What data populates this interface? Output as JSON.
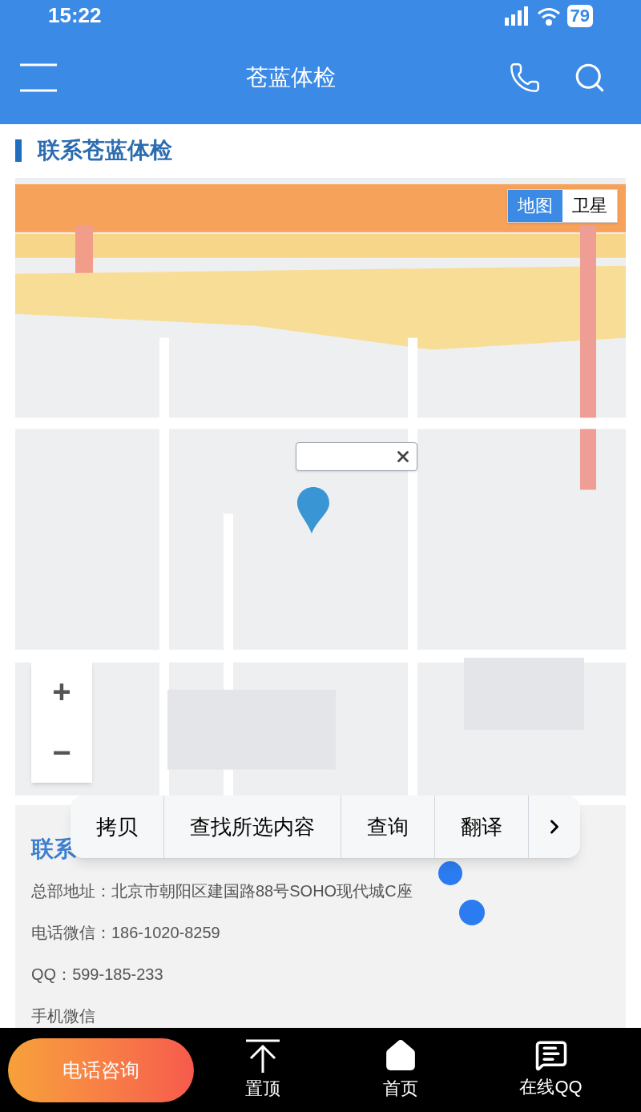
{
  "status_bar": {
    "time": "15:22",
    "battery": "79"
  },
  "header": {
    "title": "苍蓝体检"
  },
  "section": {
    "title": "联系苍蓝体检"
  },
  "map": {
    "kind": "picture",
    "map_types": [
      {
        "label": "地图",
        "selected": true
      },
      {
        "label": "卫星",
        "selected": false
      }
    ],
    "zoom_in": "+",
    "zoom_out": "−"
  },
  "contact": {
    "heading": "联系",
    "lines": [
      {
        "label": "总部地址：",
        "value": "北京市朝阳区建国路88号SOHO现代城C座"
      },
      {
        "label": "电话微信：",
        "value": "186-1020-8259"
      },
      {
        "label": "QQ：",
        "value": "599-185-233"
      },
      {
        "label": "手机微信"
      }
    ]
  },
  "context_menu": [
    "拷贝",
    "查找所选内容",
    "查询",
    "翻译"
  ],
  "bottom_bar": {
    "call_button": "电话咨询",
    "items": [
      {
        "kind": "top",
        "label": "置顶"
      },
      {
        "kind": "home",
        "label": "首页"
      },
      {
        "kind": "chat",
        "label": "在线QQ"
      }
    ]
  }
}
